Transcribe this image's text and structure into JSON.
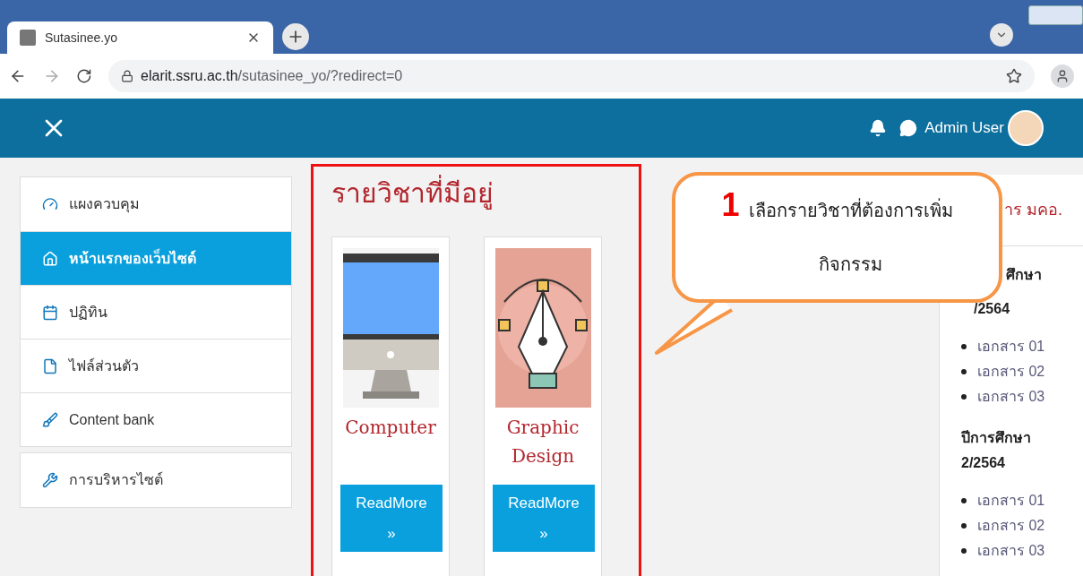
{
  "browser": {
    "tab_title": "Sutasinee.yo",
    "url_host": "elarit.ssru.ac.th",
    "url_path": "/sutasinee_yo/?redirect=0"
  },
  "navbar": {
    "user_name": "Admin User"
  },
  "sidebar": {
    "groups": [
      [
        {
          "kind": "dashboard",
          "label": "แผงควบคุม",
          "selected": false
        },
        {
          "kind": "home",
          "label": "หน้าแรกของเว็บไซต์",
          "selected": true
        },
        {
          "kind": "calendar",
          "label": "ปฏิทิน",
          "selected": false
        },
        {
          "kind": "file",
          "label": "ไฟล์ส่วนตัว",
          "selected": false
        },
        {
          "kind": "brush",
          "label": "Content bank",
          "selected": false
        }
      ],
      [
        {
          "kind": "wrench",
          "label": "การบริหารไซต์",
          "selected": false
        }
      ]
    ]
  },
  "courses": {
    "title": "รายวิชาที่มีอยู่",
    "cards": [
      {
        "kind": "computer",
        "title": "Computer",
        "button": "ReadMore",
        "arrow": "»"
      },
      {
        "kind": "pen",
        "title": "Graphic Design",
        "button": "ReadMore",
        "arrow": "»"
      }
    ]
  },
  "right_panel": {
    "heading": "าร มคอ.",
    "sections": [
      {
        "heading_lines": [
          "ศึกษา",
          "/2564"
        ],
        "items": [
          "เอกสาร 01",
          "เอกสาร 02",
          "เอกสาร 03"
        ]
      },
      {
        "heading_lines": [
          "ปีการศึกษา",
          "2/2564"
        ],
        "items": [
          "เอกสาร 01",
          "เอกสาร 02",
          "เอกสาร 03"
        ]
      }
    ]
  },
  "callout": {
    "number": "1",
    "text_lines": [
      "เลือกรายวิชาที่ต้องการเพิ่ม",
      "กิจกรรม"
    ]
  }
}
